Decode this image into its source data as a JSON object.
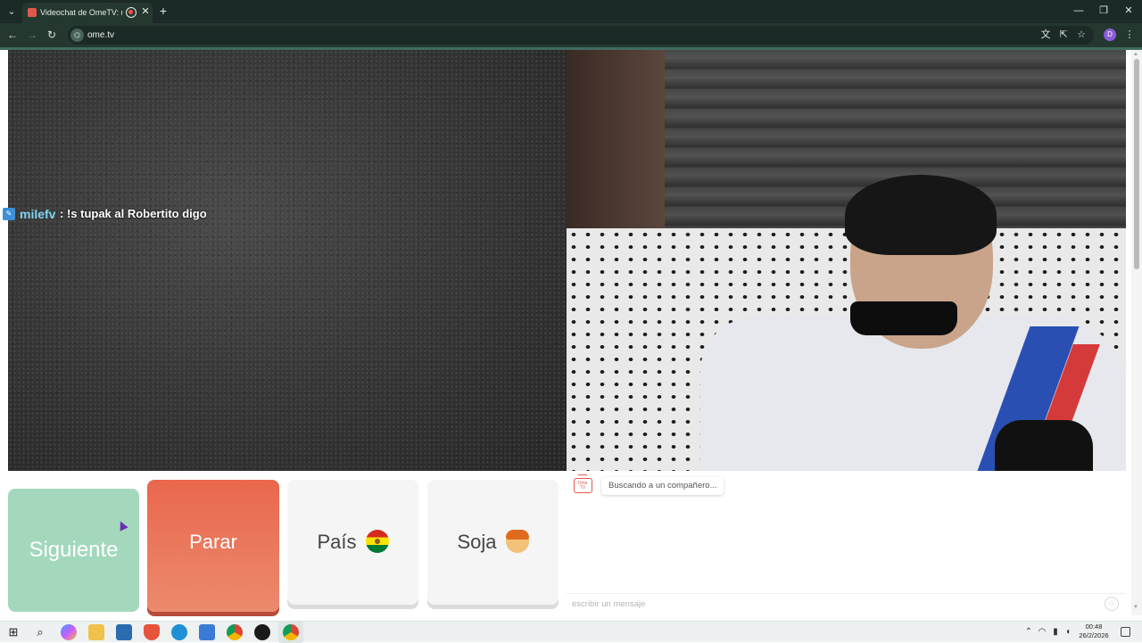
{
  "browser": {
    "tab_title": "Videochat de OmeTV: una",
    "url": "ome.tv",
    "new_tab_symbol": "+",
    "close_tab_symbol": "✕",
    "profile_initial": "D"
  },
  "stream_overlay": {
    "username": "milefv",
    "message": ": !s tupak al Robertito digo"
  },
  "controls": {
    "next_label": "Siguiente",
    "stop_label": "Parar",
    "country_label": "País",
    "gender_label": "Soja"
  },
  "chat": {
    "logo_text": "Ome TV",
    "status": "Buscando a un compañero...",
    "input_placeholder": "escribir un mensaje"
  },
  "taskbar": {
    "time": "00:48",
    "date": "26/2/2026"
  },
  "colors": {
    "next_button": "#a3d8bd",
    "stop_button": "#e9674d",
    "accent": "#e0574d",
    "chrome": "#24382f"
  },
  "icons": [
    "tab-menu-icon",
    "record-icon",
    "back-icon",
    "forward-icon",
    "reload-icon",
    "translate-icon",
    "install-icon",
    "star-icon",
    "kebab-icon",
    "bolivia-flag-icon",
    "boy-face-icon",
    "emoji-icon",
    "windows-start-icon",
    "search-icon"
  ]
}
